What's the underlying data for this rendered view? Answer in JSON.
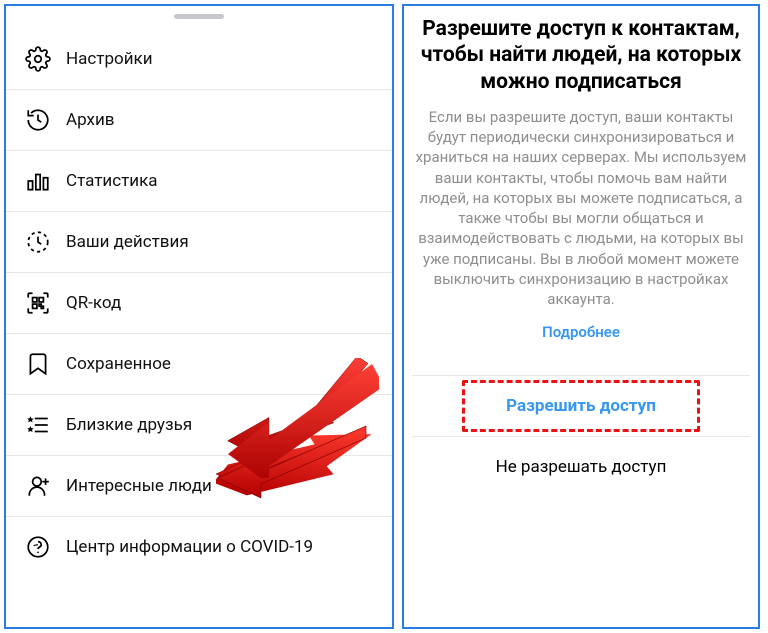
{
  "menu": {
    "items": [
      {
        "icon": "settings-icon",
        "label": "Настройки"
      },
      {
        "icon": "archive-icon",
        "label": "Архив"
      },
      {
        "icon": "stats-icon",
        "label": "Статистика"
      },
      {
        "icon": "activity-icon",
        "label": "Ваши действия"
      },
      {
        "icon": "qr-icon",
        "label": "QR-код"
      },
      {
        "icon": "saved-icon",
        "label": "Сохраненное"
      },
      {
        "icon": "close-friends-icon",
        "label": "Близкие друзья"
      },
      {
        "icon": "discover-icon",
        "label": "Интересные люди"
      },
      {
        "icon": "covid-icon",
        "label": "Центр информации о COVID-19"
      }
    ]
  },
  "dialog": {
    "title": "Разрешите доступ к контактам, чтобы найти людей, на которых можно подписаться",
    "body": "Если вы разрешите доступ, ваши контакты будут периодически синхронизироваться и храниться на наших серверах. Мы используем ваши контакты, чтобы помочь вам найти людей, на которых вы можете подписаться, а также чтобы вы могли общаться и взаимодействовать с людьми, на которых вы уже подписаны. Вы в любой момент можете выключить синхронизацию в настройках аккаунта.",
    "learn_more": "Подробнее",
    "allow": "Разрешить доступ",
    "deny": "Не разрешать доступ"
  },
  "annotations": {
    "arrow_color": "#d40000",
    "highlight_color": "#e11"
  }
}
